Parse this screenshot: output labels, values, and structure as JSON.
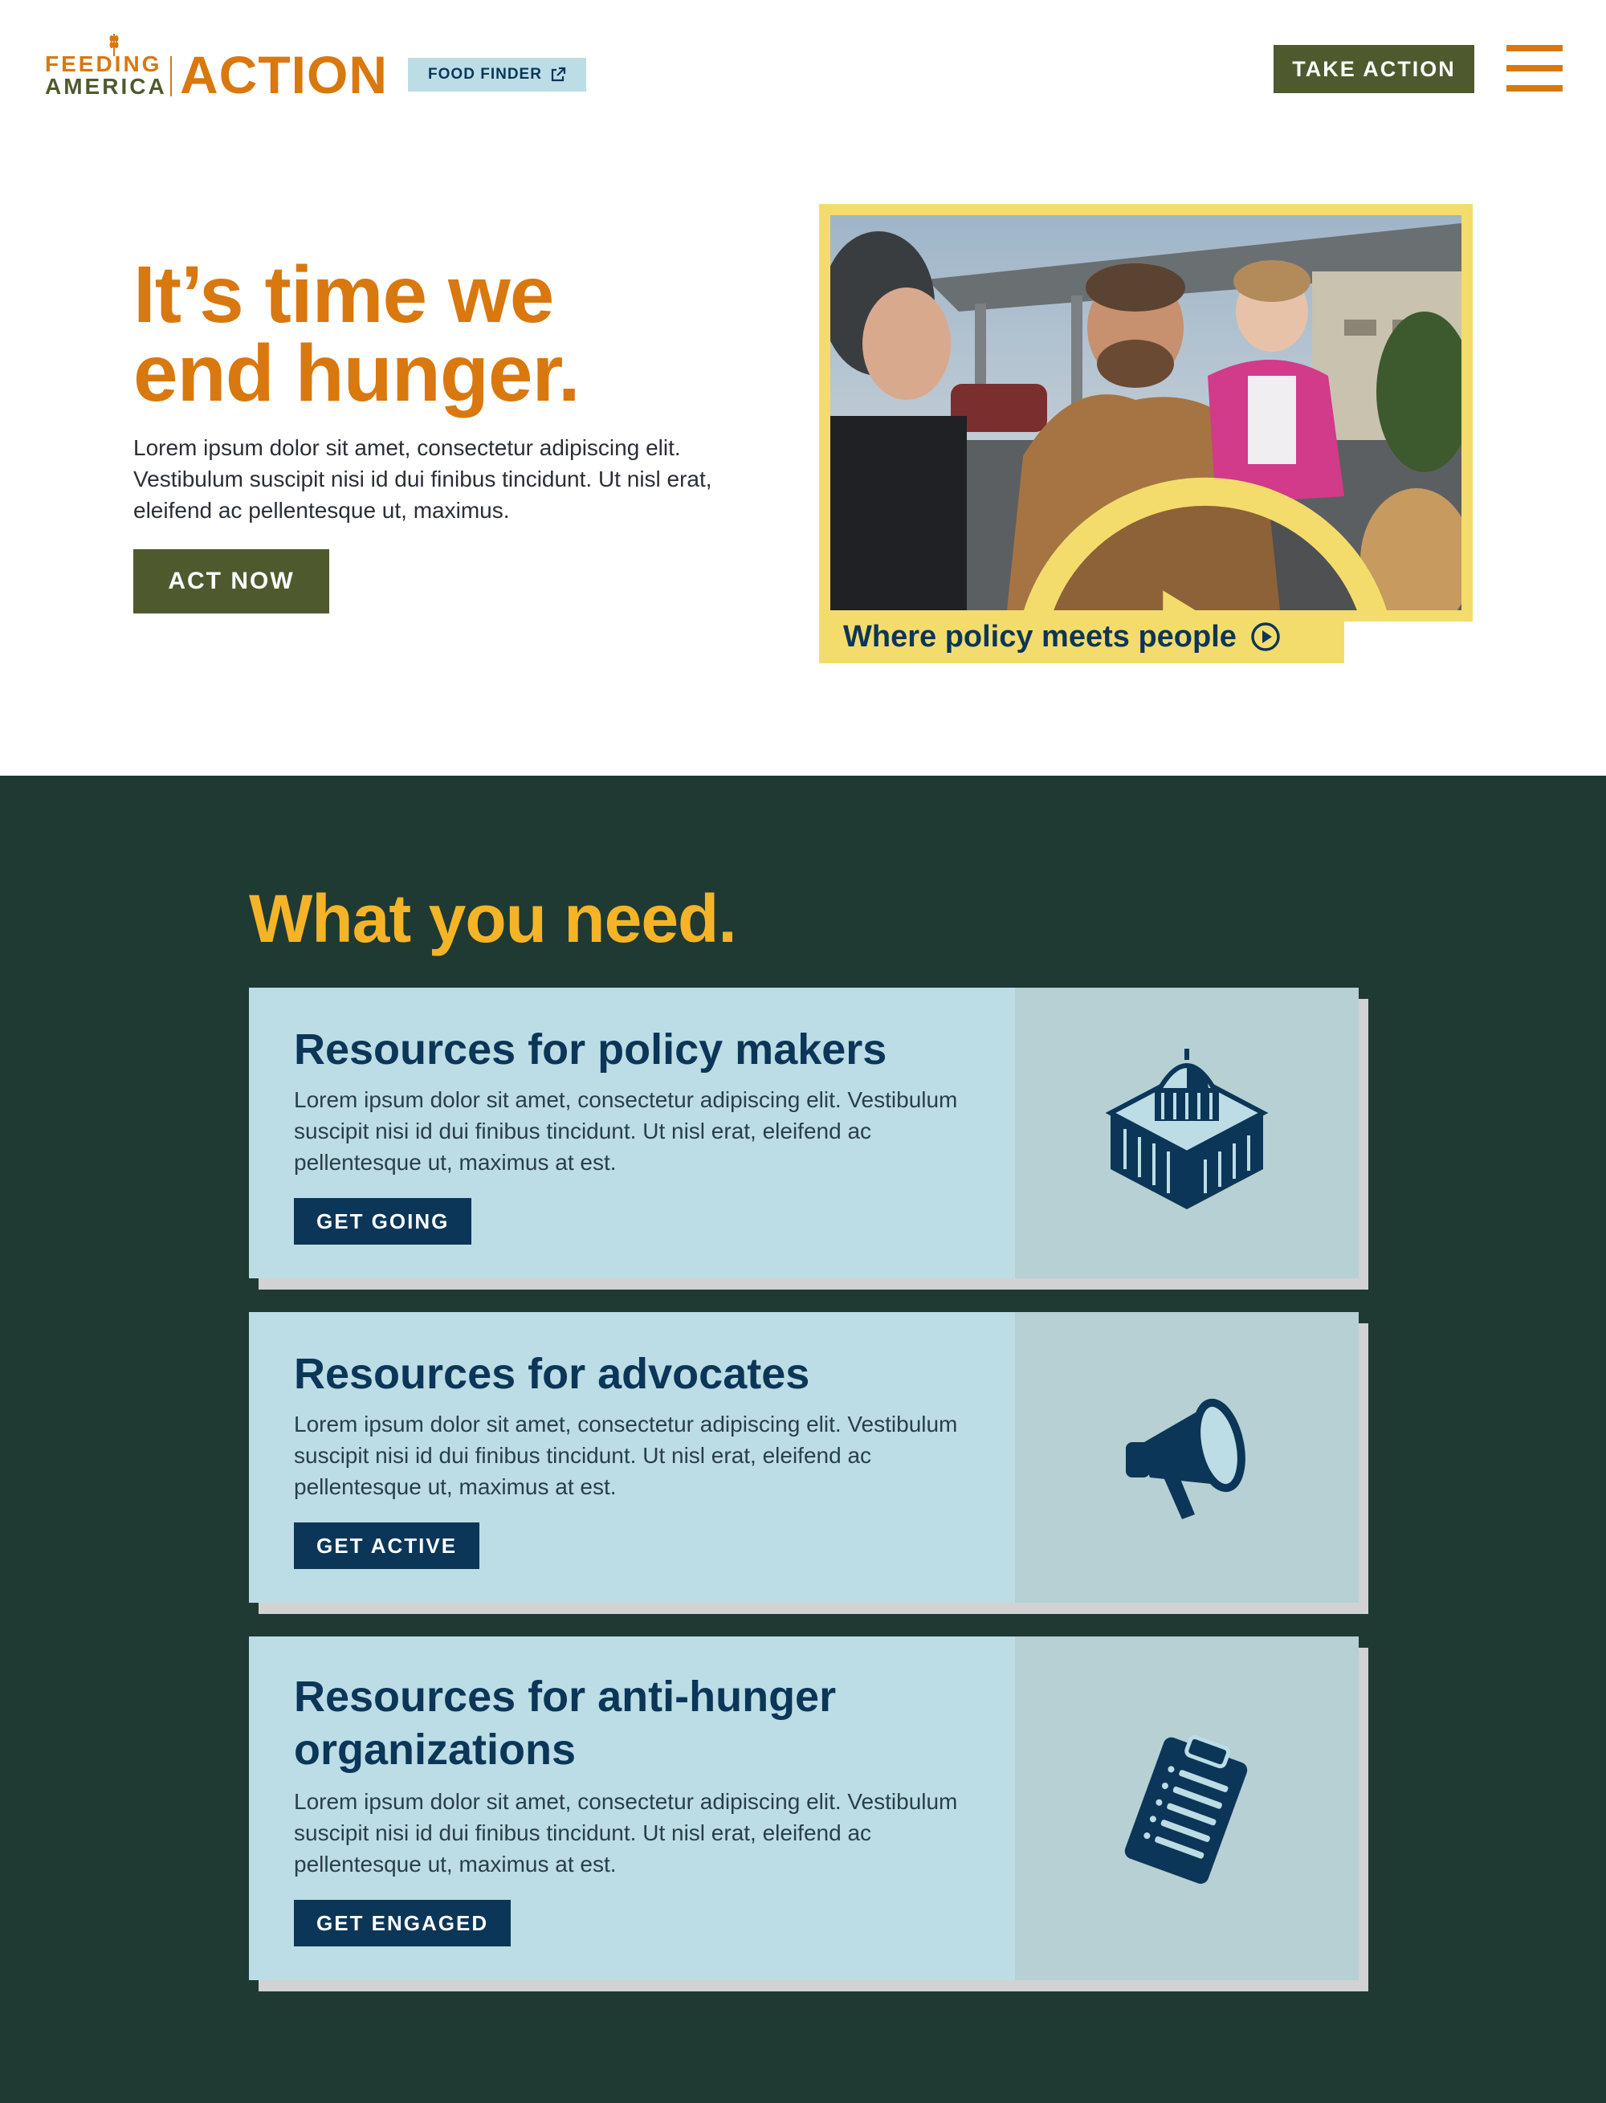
{
  "header": {
    "logo_line1": "FEEDING",
    "logo_line2": "AMERICA",
    "logo_registered": "®",
    "logo_action": "ACTION",
    "food_finder_label": "FOOD FINDER",
    "take_action_label": "TAKE ACTION",
    "menu_icon": "hamburger-menu-icon"
  },
  "hero": {
    "title_line1": "It’s time we",
    "title_line2": "end hunger.",
    "body": "Lorem ipsum dolor sit amet, consectetur adipiscing elit. Vestibulum suscipit nisi id dui finibus tincidunt. Ut nisl erat, eleifend ac pellentesque ut, maximus.",
    "cta_label": "ACT NOW",
    "video_caption": "Where policy meets people"
  },
  "resources": {
    "title": "What you need.",
    "cards": [
      {
        "title": "Resources for policy makers",
        "body": "Lorem ipsum dolor sit amet, consectetur adipiscing elit. Vestibulum suscipit nisi id dui finibus tincidunt. Ut nisl erat, eleifend ac pellentesque ut, maximus at est.",
        "button": "GET GOING",
        "icon": "capitol-building-icon"
      },
      {
        "title": "Resources for advocates",
        "body": "Lorem ipsum dolor sit amet, consectetur adipiscing elit. Vestibulum suscipit nisi id dui finibus tincidunt. Ut nisl erat, eleifend ac pellentesque ut, maximus at est.",
        "button": "GET ACTIVE",
        "icon": "megaphone-icon"
      },
      {
        "title": "Resources for anti-hunger organizations",
        "body": "Lorem ipsum dolor sit amet, consectetur adipiscing elit. Vestibulum suscipit nisi id dui finibus tincidunt. Ut nisl erat, eleifend ac pellentesque ut, maximus at est.",
        "button": "GET ENGAGED",
        "icon": "clipboard-icon"
      }
    ]
  },
  "colors": {
    "brand_orange": "#d9780f",
    "olive": "#4e5a2e",
    "navy": "#0b3658",
    "dark_green": "#1e3a33",
    "yellow": "#f5b427",
    "light_blue": "#bcdde5",
    "video_frame_yellow": "#f4dc6c"
  }
}
